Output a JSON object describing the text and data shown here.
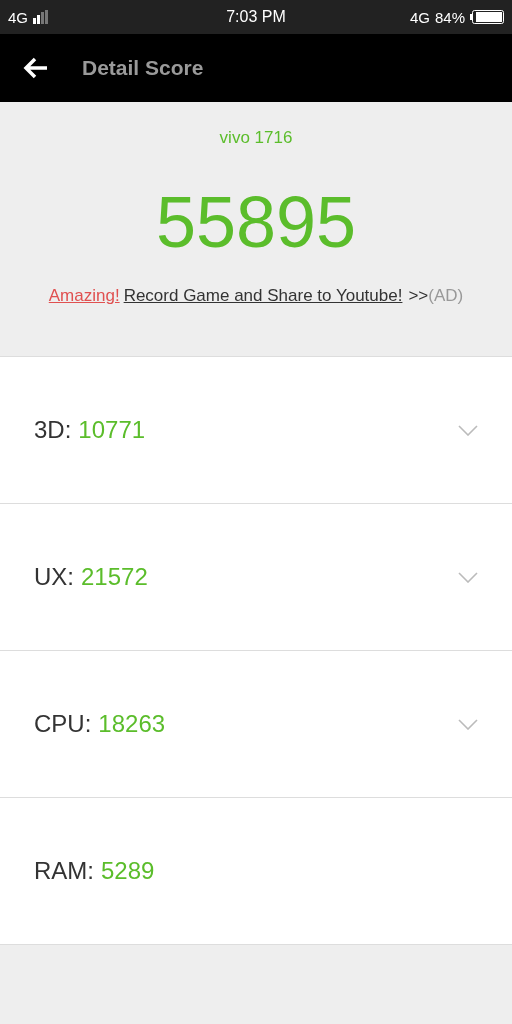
{
  "status_bar": {
    "network": "4G",
    "time": "7:03 PM",
    "data_network": "4G",
    "battery": "84%"
  },
  "header": {
    "title": "Detail Score"
  },
  "summary": {
    "device": "vivo 1716",
    "total": "55895",
    "ad": {
      "highlight": "Amazing!",
      "link": "Record Game and Share to Youtube!",
      "arrows": ">>",
      "tag": "(AD)"
    }
  },
  "scores": [
    {
      "label": "3D:",
      "value": "10771",
      "expandable": true
    },
    {
      "label": "UX:",
      "value": "21572",
      "expandable": true
    },
    {
      "label": "CPU:",
      "value": "18263",
      "expandable": true
    },
    {
      "label": "RAM:",
      "value": "5289",
      "expandable": false
    }
  ]
}
